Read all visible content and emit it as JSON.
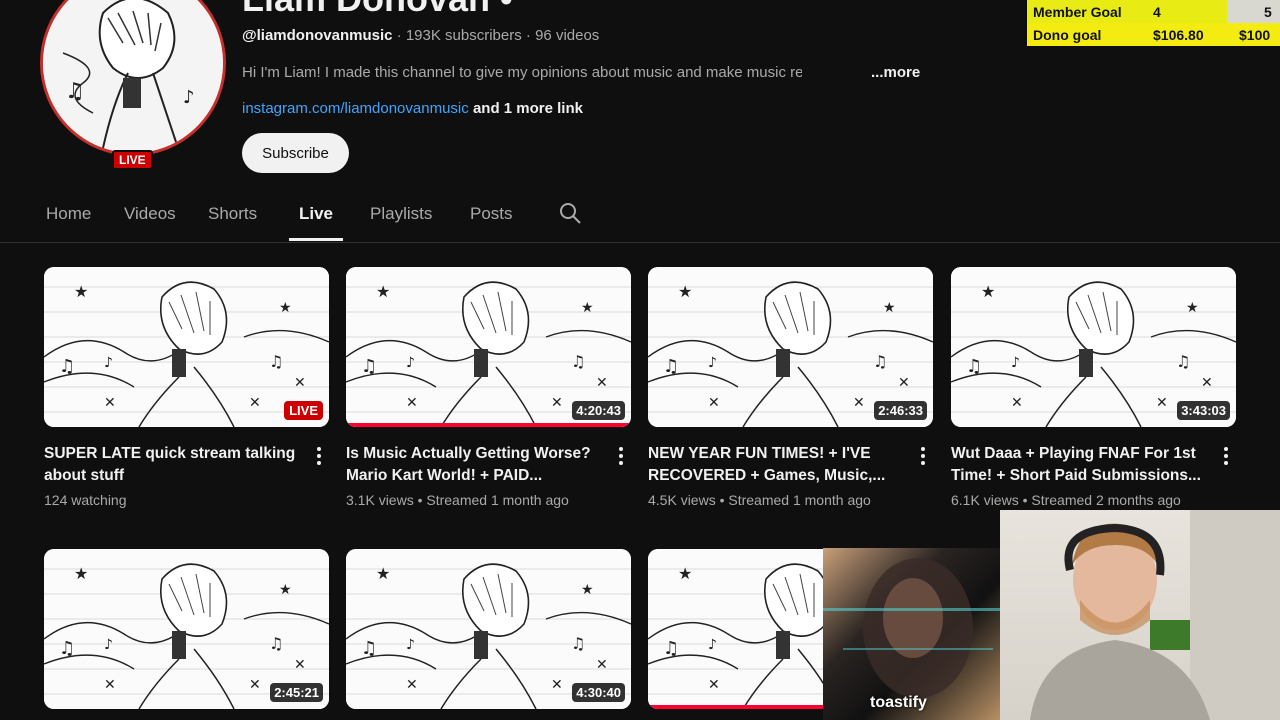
{
  "channel": {
    "name": "Liam Donovan •",
    "handle": "@liamdonovanmusic",
    "subscribers": "193K subscribers",
    "videos_count": "96 videos",
    "separator": "·",
    "description": "Hi I'm Liam! I made this channel to give my opinions about music and make music relate",
    "more_label": "...more",
    "link_text": "instagram.com/liamdonovanmusic",
    "more_links_text": "and 1 more link",
    "subscribe_label": "Subscribe",
    "live_badge": "LIVE"
  },
  "goals": {
    "member_label": "Member Goal",
    "member_current": "4",
    "member_target": "5",
    "dono_label": "Dono goal",
    "dono_current": "$106.80",
    "dono_target": "$100"
  },
  "tabs": [
    {
      "label": "Home"
    },
    {
      "label": "Videos"
    },
    {
      "label": "Shorts"
    },
    {
      "label": "Live",
      "active": true
    },
    {
      "label": "Playlists"
    },
    {
      "label": "Posts"
    }
  ],
  "videos": [
    {
      "title": "SUPER LATE quick stream talking about stuff",
      "stats": "124 watching",
      "badge": "LIVE",
      "live": true
    },
    {
      "title": "Is Music Actually Getting Worse? Mario Kart World! + PAID...",
      "stats": "3.1K views • Streamed 1 month ago",
      "badge": "4:20:43",
      "progress": 1.0
    },
    {
      "title": "NEW YEAR FUN TIMES! + I'VE RECOVERED + Games, Music,...",
      "stats": "4.5K views • Streamed 1 month ago",
      "badge": "2:46:33"
    },
    {
      "title": "Wut Daaa + Playing FNAF For 1st Time! + Short Paid Submissions...",
      "stats": "6.1K views • Streamed 2 months ago",
      "badge": "3:43:03"
    },
    {
      "badge": "2:45:21"
    },
    {
      "badge": "4:30:40"
    },
    {
      "badge": "",
      "progress": 1.0
    }
  ],
  "overlay": {
    "music_label": "toastify"
  }
}
